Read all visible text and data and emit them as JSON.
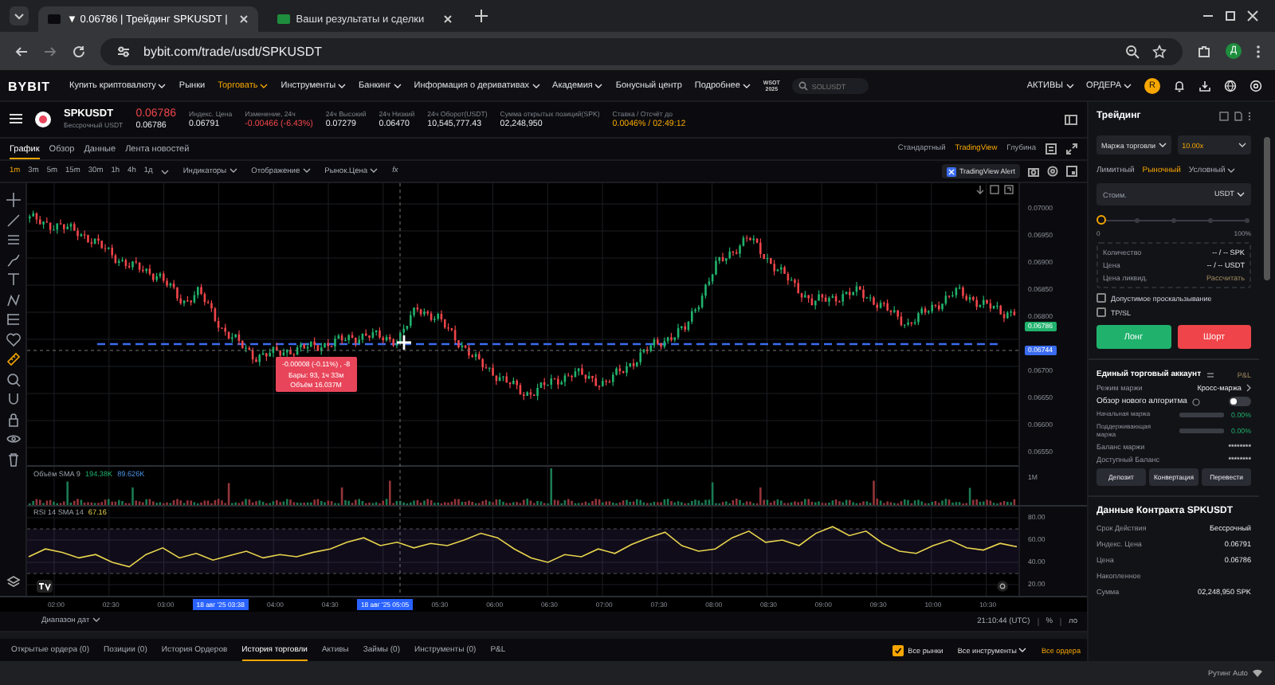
{
  "browser": {
    "tabs": [
      {
        "title": "▼ 0.06786 | Трейдинг SPKUSDT |",
        "selected": true
      },
      {
        "title": "Ваши результаты и сделки",
        "selected": false
      }
    ],
    "url": "bybit.com/trade/usdt/SPKUSDT",
    "profile": "Д"
  },
  "nav": {
    "logo": "BYBIT",
    "items": [
      {
        "label": "Купить криптовалюту",
        "dropdown": true,
        "selected": false
      },
      {
        "label": "Рынки",
        "dropdown": false,
        "selected": false
      },
      {
        "label": "Торговать",
        "dropdown": true,
        "selected": true
      },
      {
        "label": "Инструменты",
        "dropdown": true,
        "selected": false
      },
      {
        "label": "Банкинг",
        "dropdown": true,
        "selected": false
      },
      {
        "label": "Информация о деривативах",
        "dropdown": true,
        "selected": false
      },
      {
        "label": "Академия",
        "dropdown": true,
        "selected": false
      },
      {
        "label": "Бонусный центр",
        "dropdown": false,
        "selected": false
      },
      {
        "label": "Подробнее",
        "dropdown": true,
        "selected": false
      }
    ],
    "event_badge": [
      "WSOT",
      "2025"
    ],
    "search_placeholder": "SOLUSDT",
    "menus": [
      "АКТИВЫ",
      "ОРДЕРА"
    ],
    "avatar": "R"
  },
  "ticker": {
    "symbol": "SPKUSDT",
    "type": "Бессрочный USDT",
    "last_price": "0.06786",
    "mark_price": "0.06786",
    "stats": [
      {
        "label": "Индекс. Цена",
        "value": "0.06791",
        "kind": "normal"
      },
      {
        "label": "Изменение, 24ч",
        "value": "-0.00466 (-6.43%)",
        "kind": "down"
      },
      {
        "label": "24ч Высокий",
        "value": "0.07279",
        "kind": "normal"
      },
      {
        "label": "24ч Низкий",
        "value": "0.06470",
        "kind": "normal"
      },
      {
        "label": "24ч Оборот(USDT)",
        "value": "10,545,777.43",
        "kind": "normal"
      },
      {
        "label": "Сумма открытых позиций(SPK)",
        "value": "02,248,950",
        "kind": "normal"
      },
      {
        "label": "Ставка / Отсчёт до",
        "value": "0.0046% / 02:49:12",
        "kind": "accent"
      }
    ]
  },
  "chart_tabs": [
    {
      "label": "График",
      "selected": true
    },
    {
      "label": "Обзор",
      "selected": false
    },
    {
      "label": "Данные",
      "selected": false
    },
    {
      "label": "Лента новостей",
      "selected": false
    }
  ],
  "chart_modes": [
    {
      "label": "Стандартный",
      "selected": false
    },
    {
      "label": "TradingView",
      "selected": true
    },
    {
      "label": "Глубина",
      "selected": false
    }
  ],
  "timeframes": [
    {
      "label": "1m",
      "selected": true
    },
    {
      "label": "3m",
      "selected": false
    },
    {
      "label": "5m",
      "selected": false
    },
    {
      "label": "15m",
      "selected": false
    },
    {
      "label": "30m",
      "selected": false
    },
    {
      "label": "1h",
      "selected": false
    },
    {
      "label": "4h",
      "selected": false
    },
    {
      "label": "1д",
      "selected": false
    }
  ],
  "chart_menus": [
    "Индикаторы",
    "Отображение",
    "Рынок.Цена"
  ],
  "fx": "fx",
  "alert_button": "TradingView Alert",
  "price_axis": [
    {
      "label": "0.07000",
      "kind": "tick"
    },
    {
      "label": "0.06950",
      "kind": "tick"
    },
    {
      "label": "0.06900",
      "kind": "tick"
    },
    {
      "label": "0.06850",
      "kind": "tick"
    },
    {
      "label": "0.06800",
      "kind": "tick"
    },
    {
      "label": "0.06786",
      "kind": "last"
    },
    {
      "label": "0.06744",
      "kind": "cursor"
    },
    {
      "label": "0.06700",
      "kind": "tick"
    },
    {
      "label": "0.06650",
      "kind": "tick"
    },
    {
      "label": "0.06600",
      "kind": "tick"
    },
    {
      "label": "0.06550",
      "kind": "tick"
    }
  ],
  "tooltip": [
    "-0.00008 (-0.11%) , -8",
    "Бары: 93, 1ч 33м",
    "Объём 16.037M"
  ],
  "volume_legend": {
    "name": "Объём SMA 9",
    "values": [
      "194.38K",
      "89.626K"
    ]
  },
  "volume_axis": "1M",
  "rsi": {
    "legend": "RSI 14 SMA 14",
    "value": "67.16",
    "chart_data": {
      "type": "line",
      "ylim": [
        20,
        80
      ],
      "grid": true,
      "ref_lines": [
        {
          "axis": "y",
          "value": 70
        },
        {
          "axis": "y",
          "value": 30
        }
      ],
      "yticks": [
        {
          "value": 80,
          "label": "80.00"
        },
        {
          "value": 60,
          "label": "60.00"
        },
        {
          "value": 40,
          "label": "40.00"
        },
        {
          "value": 20,
          "label": "20.00"
        }
      ],
      "series": [
        {
          "color": "#e8d44d",
          "values": [
            45,
            52,
            49,
            44,
            47,
            40,
            36,
            47,
            53,
            44,
            48,
            42,
            46,
            50,
            44,
            47,
            45,
            49,
            52,
            58,
            62,
            55,
            58,
            53,
            57,
            55,
            60,
            66,
            62,
            52,
            44,
            40,
            47,
            45,
            52,
            48,
            56,
            62,
            67,
            55,
            50,
            52,
            62,
            68,
            58,
            60,
            55,
            66,
            72,
            64,
            68,
            57,
            50,
            48,
            55,
            60,
            53,
            51,
            57,
            54
          ]
        }
      ]
    }
  },
  "time_axis": [
    {
      "label": "02:00",
      "kind": "tick"
    },
    {
      "label": "02:30",
      "kind": "tick"
    },
    {
      "label": "03:00",
      "kind": "tick"
    },
    {
      "label": "18 авг '25  03:38",
      "kind": "marker"
    },
    {
      "label": "04:00",
      "kind": "tick"
    },
    {
      "label": "04:30",
      "kind": "tick"
    },
    {
      "label": "18 авг '25  05:05",
      "kind": "marker"
    },
    {
      "label": "05:30",
      "kind": "tick"
    },
    {
      "label": "06:00",
      "kind": "tick"
    },
    {
      "label": "06:30",
      "kind": "tick"
    },
    {
      "label": "07:00",
      "kind": "tick"
    },
    {
      "label": "07:30",
      "kind": "tick"
    },
    {
      "label": "08:00",
      "kind": "tick"
    },
    {
      "label": "08:30",
      "kind": "tick"
    },
    {
      "label": "09:00",
      "kind": "tick"
    },
    {
      "label": "09:30",
      "kind": "tick"
    },
    {
      "label": "10:00",
      "kind": "tick"
    },
    {
      "label": "10:30",
      "kind": "tick"
    }
  ],
  "date_range": "Диапазон дат",
  "clock": "21:10:44 (UTC)",
  "scale_buttons": [
    "%",
    "ло"
  ],
  "bottom_tabs": [
    {
      "label": "Открытые ордера (0)",
      "selected": false
    },
    {
      "label": "Позиции (0)",
      "selected": false
    },
    {
      "label": "История Ордеров",
      "selected": false
    },
    {
      "label": "История торговли",
      "selected": true
    },
    {
      "label": "Активы",
      "selected": false
    },
    {
      "label": "Займы (0)",
      "selected": false
    },
    {
      "label": "Инструменты (0)",
      "selected": false
    },
    {
      "label": "P&L",
      "selected": false
    }
  ],
  "bottom_filters": {
    "all_markets": {
      "label": "Все рынки",
      "checked": true
    },
    "instruments": "Все инструменты",
    "orders": "Все ордера"
  },
  "panel": {
    "title": "Трейдинг",
    "margin_mode": "Маржа торговли",
    "leverage": "10.00x",
    "order_types": [
      {
        "label": "Лимитный",
        "selected": false,
        "dropdown": false
      },
      {
        "label": "Рыночный",
        "selected": true,
        "dropdown": false
      },
      {
        "label": "Условный",
        "selected": false,
        "dropdown": true
      }
    ],
    "amount": {
      "placeholder": "Стоим.",
      "unit": "USDT"
    },
    "slider": {
      "level": 0,
      "min_label": "0",
      "max_label": "100%"
    },
    "info": [
      {
        "label": "Количество",
        "value": "-- / -- SPK",
        "kind": "text"
      },
      {
        "label": "Цена",
        "value": "-- / -- USDT",
        "kind": "text"
      },
      {
        "label": "Цена ликвид.",
        "value": "Рассчитать",
        "kind": "link"
      }
    ],
    "options": [
      {
        "label": "Допустимое проскальзывание",
        "checked": false
      },
      {
        "label": "TP/SL",
        "checked": false
      }
    ],
    "long": "Лонг",
    "short": "Шорт",
    "account": {
      "title": "Единый торговый аккаунт",
      "pnl": "P&L",
      "margin_mode_label": "Режим маржи",
      "margin_mode_value": "Кросс-маржа",
      "algo": {
        "label": "Обзор нового алгоритма",
        "on": false
      },
      "margins": [
        {
          "label": "Начальная маржа",
          "value": "0.00%"
        },
        {
          "label": "Поддерживающая маржа",
          "value": "0.00%"
        }
      ],
      "balances": [
        {
          "label": "Баланс маржи",
          "value": "********"
        },
        {
          "label": "Доступный Баланс",
          "value": "********"
        }
      ],
      "actions": [
        "Депозит",
        "Конвертация",
        "Перевести"
      ]
    },
    "contract": {
      "title": "Данные Контракта SPKUSDT",
      "rows": [
        {
          "label": "Срок Действия",
          "value": "Бессрочный"
        },
        {
          "label": "Индекс. Цена",
          "value": "0.06791"
        },
        {
          "label": "Цена",
          "value": "0.06786"
        },
        {
          "label": "Накопленное"
        },
        {
          "label": "Сумма",
          "value": "02,248,950 SPK"
        }
      ]
    }
  },
  "footer": "Рутинг Auto"
}
